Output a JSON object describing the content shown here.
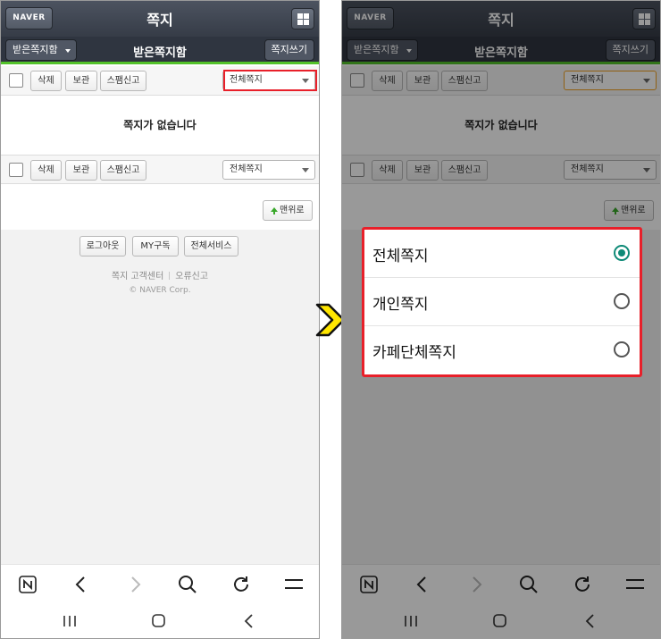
{
  "header": {
    "logo": "NAVER",
    "title": "쪽지"
  },
  "subheader": {
    "folder_label": "받은쪽지함",
    "title": "받은쪽지함",
    "compose_label": "쪽지쓰기"
  },
  "toolbar": {
    "delete_label": "삭제",
    "keep_label": "보관",
    "spam_label": "스팸신고",
    "filter_value": "전체쪽지"
  },
  "list": {
    "empty_message": "쪽지가 없습니다"
  },
  "top_button": {
    "label": "맨위로"
  },
  "footer": {
    "buttons": [
      "로그아웃",
      "MY구독",
      "전체서비스"
    ],
    "links": [
      "쪽지 고객센터",
      "오류신고"
    ],
    "copyright": "© NAVER Corp."
  },
  "filter_dialog": {
    "options": [
      {
        "label": "전체쪽지",
        "selected": true
      },
      {
        "label": "개인쪽지",
        "selected": false
      },
      {
        "label": "카페단체쪽지",
        "selected": false
      }
    ]
  },
  "colors": {
    "highlight": "#e8202a",
    "accent_green": "#53c22a",
    "radio_selected": "#0e8a77",
    "arrow_yellow": "#ffe600"
  },
  "icons": [
    "naver-n-icon",
    "back-icon",
    "forward-icon",
    "search-icon",
    "refresh-icon",
    "menu-icon",
    "recent-apps-icon",
    "home-icon",
    "system-back-icon",
    "grid-icon",
    "up-arrow-icon",
    "next-step-arrow-icon"
  ]
}
